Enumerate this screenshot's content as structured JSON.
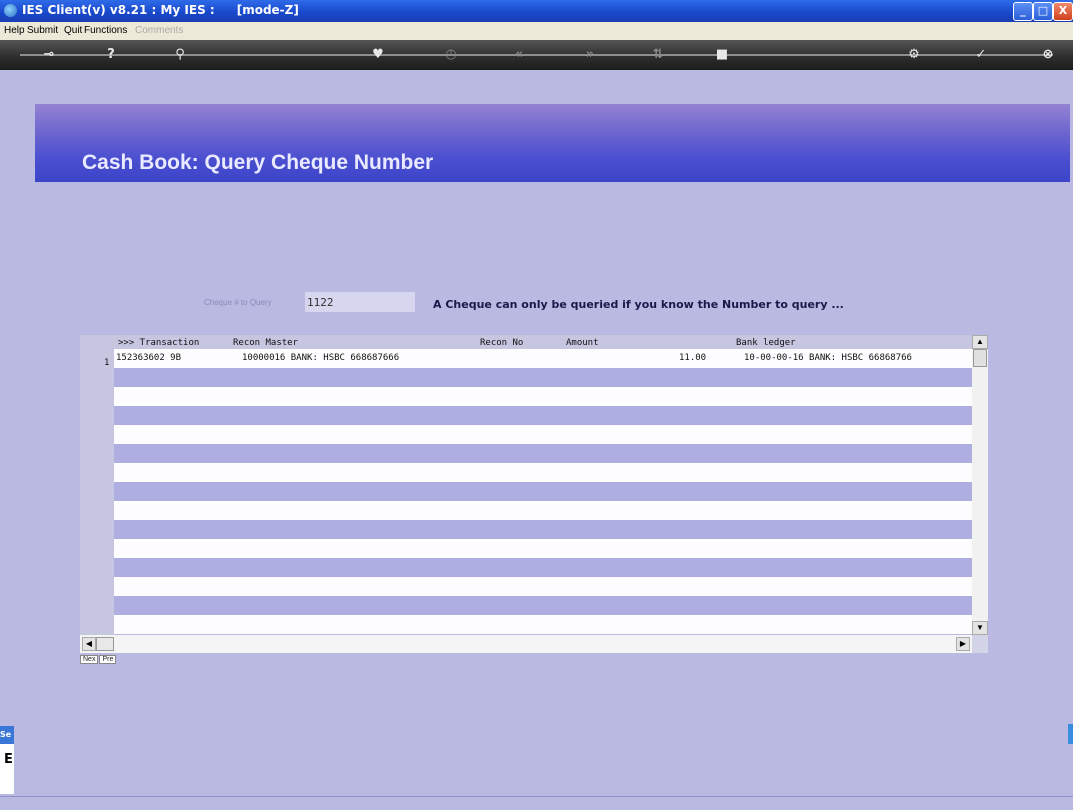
{
  "window": {
    "title": "IES Client(v) v8.21 : My IES :",
    "mode": "[mode-Z]",
    "buttons": {
      "minimize": "_",
      "maximize": "□",
      "close": "X"
    }
  },
  "menu": {
    "items": [
      "Help",
      "Submit",
      "Quit",
      "Functions"
    ],
    "disabled_item": "Comments"
  },
  "toolbar": {
    "icons": [
      "key-icon",
      "help-icon",
      "search-icon",
      "heart-icon",
      "clock-icon",
      "rewind-icon",
      "forward-icon",
      "sort-icon",
      "stop-icon",
      "gear-icon",
      "check-icon",
      "close-icon"
    ]
  },
  "page": {
    "title": "Cash Book: Query Cheque Number"
  },
  "query": {
    "label": "Cheque # to Query",
    "value": "1122",
    "hint": "A Cheque can only be queried if you know the Number to query ..."
  },
  "grid": {
    "columns": {
      "transaction": ">>> Transaction",
      "recon_master": "Recon Master",
      "recon_no": "Recon No",
      "amount": "Amount",
      "bank_ledger": "Bank ledger"
    },
    "rows": [
      {
        "num": "1",
        "transaction": "152363602 9B",
        "recon_master": "10000016 BANK: HSBC 668687666",
        "recon_no": "",
        "amount": "11.00",
        "bank_ledger": "10-00-00-16 BANK: HSBC 66868766"
      }
    ],
    "nav": {
      "next": "Nex",
      "prev": "Pre"
    }
  },
  "side": {
    "tab_caption": "Se",
    "tab_glyph": "E"
  },
  "colors": {
    "background": "#b9b9e2",
    "banner": "#4b4fd0",
    "row_white": "#fdfdff",
    "row_blue": "#aeaee0"
  }
}
